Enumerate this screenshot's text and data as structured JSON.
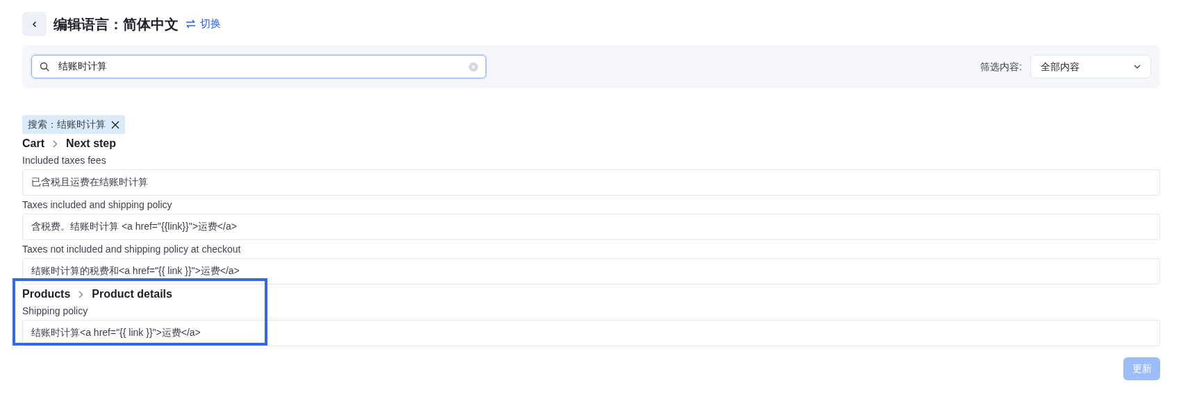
{
  "header": {
    "title": "编辑语言：简体中文",
    "switch_link": "切换"
  },
  "search": {
    "value": "结账时计算"
  },
  "filter": {
    "label": "筛选内容:",
    "value": "全部内容"
  },
  "search_tag": {
    "text": "搜索：结账时计算"
  },
  "sections": [
    {
      "breadcrumb": [
        "Cart",
        "Next step"
      ],
      "highlighted": false,
      "fields": [
        {
          "label": "Included taxes fees",
          "value": "已含税且运费在结账时计算"
        },
        {
          "label": "Taxes included and shipping policy",
          "value": "含税费。结账时计算 <a href=\"{{link}}\">运费</a>"
        },
        {
          "label": "Taxes not included and shipping policy at checkout",
          "value": "结账时计算的税费和<a href=\"{{ link }}\">运费</a>"
        }
      ]
    },
    {
      "breadcrumb": [
        "Products",
        "Product details"
      ],
      "highlighted": true,
      "fields": [
        {
          "label": "Shipping policy",
          "value": "结账时计算<a href=\"{{ link }}\">运费</a>"
        }
      ]
    }
  ],
  "update_button": {
    "label": "更新",
    "disabled": true
  }
}
